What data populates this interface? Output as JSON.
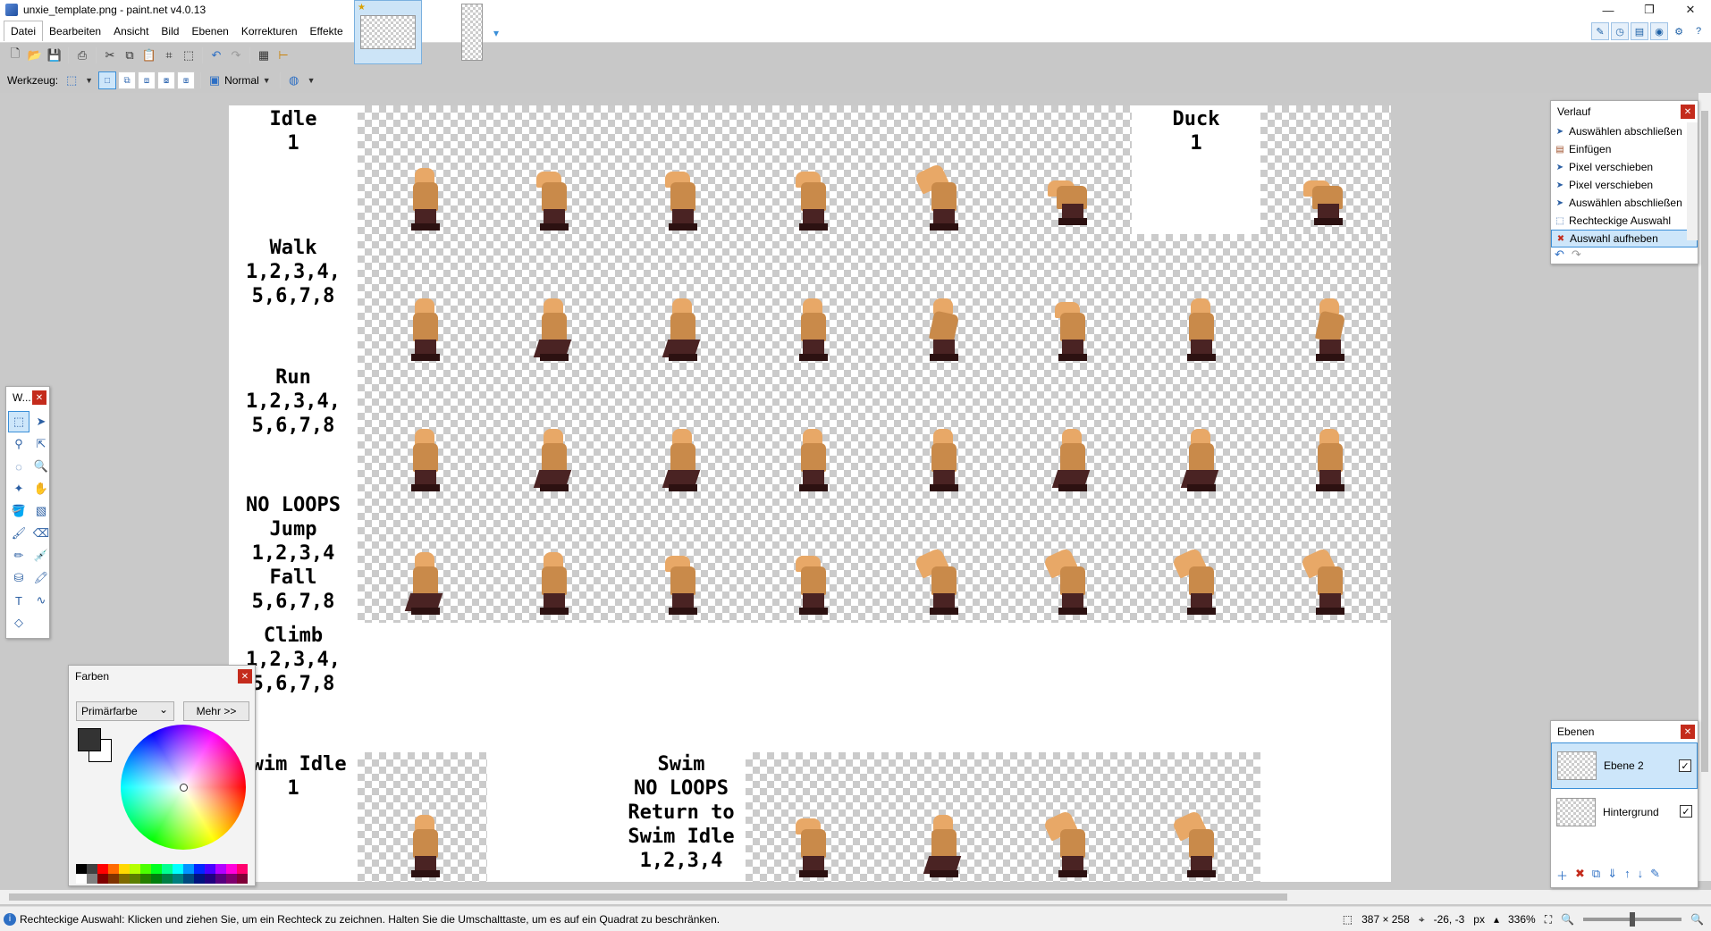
{
  "window": {
    "title": "unxie_template.png - paint.net v4.0.13"
  },
  "menu": [
    "Datei",
    "Bearbeiten",
    "Ansicht",
    "Bild",
    "Ebenen",
    "Korrekturen",
    "Effekte"
  ],
  "toolbar2": {
    "tool_label": "Werkzeug:",
    "blend_mode": "Normal"
  },
  "canvas": {
    "labels": {
      "idle": "Idle\n1",
      "duck": "Duck\n1",
      "walk": "Walk\n1,2,3,4,\n5,6,7,8",
      "run": "Run\n1,2,3,4,\n5,6,7,8",
      "jump": "NO LOOPS\nJump\n1,2,3,4\nFall\n5,6,7,8",
      "climb": "Climb\n1,2,3,4,\n5,6,7,8",
      "swimidle": "Swim Idle\n1",
      "swim": "Swim\nNO LOOPS\nReturn to\nSwim Idle\n1,2,3,4"
    }
  },
  "tools_panel": {
    "title": "W..."
  },
  "colors_panel": {
    "title": "Farben",
    "selector": "Primärfarbe",
    "more_button": "Mehr >>",
    "primary": "#333333",
    "secondary": "#ffffff"
  },
  "history_panel": {
    "title": "Verlauf",
    "items": [
      "Auswählen abschließen",
      "Einfügen",
      "Pixel verschieben",
      "Pixel verschieben",
      "Auswählen abschließen",
      "Rechteckige Auswahl",
      "Auswahl aufheben"
    ]
  },
  "layers_panel": {
    "title": "Ebenen",
    "layers": [
      {
        "name": "Ebene 2",
        "visible": true
      },
      {
        "name": "Hintergrund",
        "visible": true
      }
    ]
  },
  "status": {
    "hint": "Rechteckige Auswahl: Klicken und ziehen Sie, um ein Rechteck zu zeichnen. Halten Sie die Umschalttaste, um es auf ein Quadrat zu beschränken.",
    "image_size": "387 × 258",
    "cursor": "-26, -3",
    "units": "px",
    "zoom": "336%"
  }
}
